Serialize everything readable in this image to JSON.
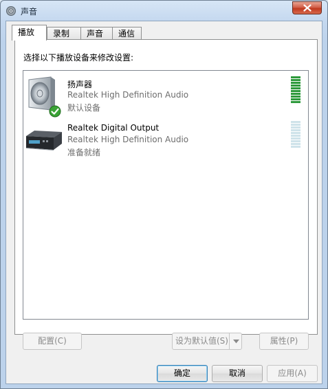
{
  "window": {
    "title": "声音"
  },
  "tabs": [
    {
      "label": "播放",
      "active": true
    },
    {
      "label": "录制",
      "active": false
    },
    {
      "label": "声音",
      "active": false
    },
    {
      "label": "通信",
      "active": false
    }
  ],
  "panel": {
    "instruction": "选择以下播放设备来修改设置:",
    "devices": [
      {
        "name": "扬声器",
        "description": "Realtek High Definition Audio",
        "status": "默认设备",
        "is_default": true,
        "level": 1.0
      },
      {
        "name": "Realtek Digital Output",
        "description": "Realtek High Definition Audio",
        "status": "准备就绪",
        "is_default": false,
        "level": 0.0
      }
    ],
    "configure_label": "配置(C)",
    "set_default_label": "设为默认值(S)",
    "properties_label": "属性(P)"
  },
  "footer": {
    "ok_label": "确定",
    "cancel_label": "取消",
    "apply_label": "应用(A)"
  },
  "colors": {
    "meter_active": "#2e9a3c",
    "meter_inactive": "#cfe3ea",
    "check": "#3aa336"
  }
}
